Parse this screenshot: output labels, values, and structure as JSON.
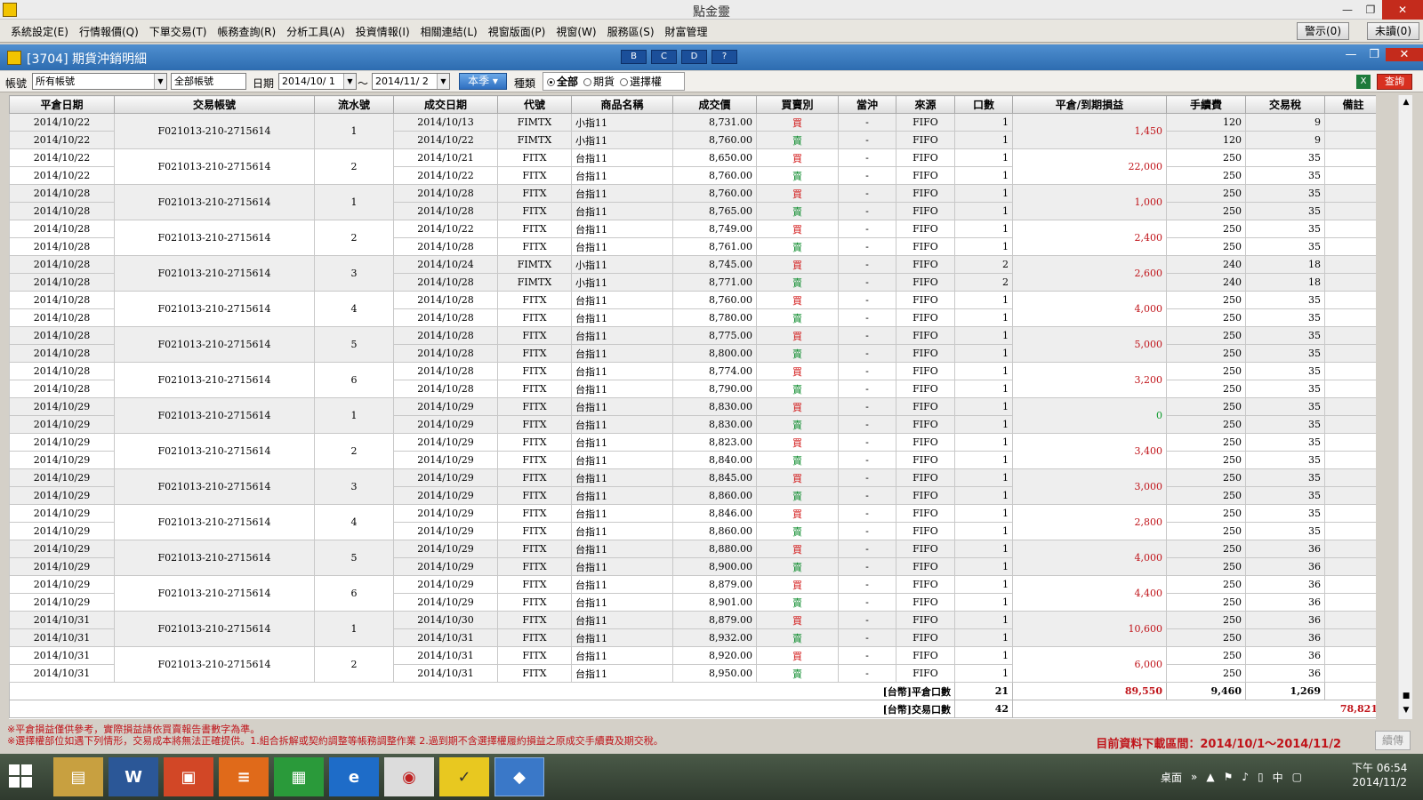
{
  "window": {
    "title": "點金靈"
  },
  "menu": {
    "items": [
      "系統設定(E)",
      "行情報價(Q)",
      "下單交易(T)",
      "帳務查詢(R)",
      "分析工具(A)",
      "投資情報(I)",
      "相關連結(L)",
      "視窗版面(P)",
      "視窗(W)",
      "服務區(S)",
      "財富管理"
    ],
    "alert": "警示(0)",
    "unread": "未讀(0)"
  },
  "panel": {
    "title": "[3704] 期貨沖銷明細",
    "tools": [
      "B",
      "C",
      "D",
      "?"
    ]
  },
  "filter": {
    "account_label": "帳號",
    "account_value": "所有帳號",
    "account_text": "全部帳號",
    "date_label": "日期",
    "date_from": "2014/10/ 1",
    "tilde": "～",
    "date_to": "2014/11/ 2",
    "season_button": "本季",
    "type_label": "種類",
    "radio_all": "全部",
    "radio_futures": "期貨",
    "radio_options": "選擇權",
    "query_button": "查詢"
  },
  "columns": [
    "平倉日期",
    "交易帳號",
    "流水號",
    "成交日期",
    "代號",
    "商品名稱",
    "成交價",
    "買賣別",
    "當沖",
    "來源",
    "口數",
    "平倉/到期損益",
    "手續費",
    "交易稅",
    "備註"
  ],
  "groups": [
    {
      "acct": "F021013-210-2715614",
      "serial": "1",
      "pnl": "1,450",
      "rows": [
        [
          "2014/10/22",
          "2014/10/13",
          "FIMTX",
          "小指11",
          "8,731.00",
          "買",
          "-",
          "FIFO",
          "1",
          "120",
          "9"
        ],
        [
          "2014/10/22",
          "2014/10/22",
          "FIMTX",
          "小指11",
          "8,760.00",
          "賣",
          "-",
          "FIFO",
          "1",
          "120",
          "9"
        ]
      ]
    },
    {
      "acct": "F021013-210-2715614",
      "serial": "2",
      "pnl": "22,000",
      "rows": [
        [
          "2014/10/22",
          "2014/10/21",
          "FITX",
          "台指11",
          "8,650.00",
          "買",
          "-",
          "FIFO",
          "1",
          "250",
          "35"
        ],
        [
          "2014/10/22",
          "2014/10/22",
          "FITX",
          "台指11",
          "8,760.00",
          "賣",
          "-",
          "FIFO",
          "1",
          "250",
          "35"
        ]
      ]
    },
    {
      "acct": "F021013-210-2715614",
      "serial": "1",
      "pnl": "1,000",
      "rows": [
        [
          "2014/10/28",
          "2014/10/28",
          "FITX",
          "台指11",
          "8,760.00",
          "買",
          "-",
          "FIFO",
          "1",
          "250",
          "35"
        ],
        [
          "2014/10/28",
          "2014/10/28",
          "FITX",
          "台指11",
          "8,765.00",
          "賣",
          "-",
          "FIFO",
          "1",
          "250",
          "35"
        ]
      ]
    },
    {
      "acct": "F021013-210-2715614",
      "serial": "2",
      "pnl": "2,400",
      "rows": [
        [
          "2014/10/28",
          "2014/10/22",
          "FITX",
          "台指11",
          "8,749.00",
          "買",
          "-",
          "FIFO",
          "1",
          "250",
          "35"
        ],
        [
          "2014/10/28",
          "2014/10/28",
          "FITX",
          "台指11",
          "8,761.00",
          "賣",
          "-",
          "FIFO",
          "1",
          "250",
          "35"
        ]
      ]
    },
    {
      "acct": "F021013-210-2715614",
      "serial": "3",
      "pnl": "2,600",
      "rows": [
        [
          "2014/10/28",
          "2014/10/24",
          "FIMTX",
          "小指11",
          "8,745.00",
          "買",
          "-",
          "FIFO",
          "2",
          "240",
          "18"
        ],
        [
          "2014/10/28",
          "2014/10/28",
          "FIMTX",
          "小指11",
          "8,771.00",
          "賣",
          "-",
          "FIFO",
          "2",
          "240",
          "18"
        ]
      ]
    },
    {
      "acct": "F021013-210-2715614",
      "serial": "4",
      "pnl": "4,000",
      "rows": [
        [
          "2014/10/28",
          "2014/10/28",
          "FITX",
          "台指11",
          "8,760.00",
          "買",
          "-",
          "FIFO",
          "1",
          "250",
          "35"
        ],
        [
          "2014/10/28",
          "2014/10/28",
          "FITX",
          "台指11",
          "8,780.00",
          "賣",
          "-",
          "FIFO",
          "1",
          "250",
          "35"
        ]
      ]
    },
    {
      "acct": "F021013-210-2715614",
      "serial": "5",
      "pnl": "5,000",
      "rows": [
        [
          "2014/10/28",
          "2014/10/28",
          "FITX",
          "台指11",
          "8,775.00",
          "買",
          "-",
          "FIFO",
          "1",
          "250",
          "35"
        ],
        [
          "2014/10/28",
          "2014/10/28",
          "FITX",
          "台指11",
          "8,800.00",
          "賣",
          "-",
          "FIFO",
          "1",
          "250",
          "35"
        ]
      ]
    },
    {
      "acct": "F021013-210-2715614",
      "serial": "6",
      "pnl": "3,200",
      "rows": [
        [
          "2014/10/28",
          "2014/10/28",
          "FITX",
          "台指11",
          "8,774.00",
          "買",
          "-",
          "FIFO",
          "1",
          "250",
          "35"
        ],
        [
          "2014/10/28",
          "2014/10/28",
          "FITX",
          "台指11",
          "8,790.00",
          "賣",
          "-",
          "FIFO",
          "1",
          "250",
          "35"
        ]
      ]
    },
    {
      "acct": "F021013-210-2715614",
      "serial": "1",
      "pnl": "0",
      "rows": [
        [
          "2014/10/29",
          "2014/10/29",
          "FITX",
          "台指11",
          "8,830.00",
          "買",
          "-",
          "FIFO",
          "1",
          "250",
          "35"
        ],
        [
          "2014/10/29",
          "2014/10/29",
          "FITX",
          "台指11",
          "8,830.00",
          "賣",
          "-",
          "FIFO",
          "1",
          "250",
          "35"
        ]
      ]
    },
    {
      "acct": "F021013-210-2715614",
      "serial": "2",
      "pnl": "3,400",
      "rows": [
        [
          "2014/10/29",
          "2014/10/29",
          "FITX",
          "台指11",
          "8,823.00",
          "買",
          "-",
          "FIFO",
          "1",
          "250",
          "35"
        ],
        [
          "2014/10/29",
          "2014/10/29",
          "FITX",
          "台指11",
          "8,840.00",
          "賣",
          "-",
          "FIFO",
          "1",
          "250",
          "35"
        ]
      ]
    },
    {
      "acct": "F021013-210-2715614",
      "serial": "3",
      "pnl": "3,000",
      "rows": [
        [
          "2014/10/29",
          "2014/10/29",
          "FITX",
          "台指11",
          "8,845.00",
          "買",
          "-",
          "FIFO",
          "1",
          "250",
          "35"
        ],
        [
          "2014/10/29",
          "2014/10/29",
          "FITX",
          "台指11",
          "8,860.00",
          "賣",
          "-",
          "FIFO",
          "1",
          "250",
          "35"
        ]
      ]
    },
    {
      "acct": "F021013-210-2715614",
      "serial": "4",
      "pnl": "2,800",
      "rows": [
        [
          "2014/10/29",
          "2014/10/29",
          "FITX",
          "台指11",
          "8,846.00",
          "買",
          "-",
          "FIFO",
          "1",
          "250",
          "35"
        ],
        [
          "2014/10/29",
          "2014/10/29",
          "FITX",
          "台指11",
          "8,860.00",
          "賣",
          "-",
          "FIFO",
          "1",
          "250",
          "35"
        ]
      ]
    },
    {
      "acct": "F021013-210-2715614",
      "serial": "5",
      "pnl": "4,000",
      "rows": [
        [
          "2014/10/29",
          "2014/10/29",
          "FITX",
          "台指11",
          "8,880.00",
          "買",
          "-",
          "FIFO",
          "1",
          "250",
          "36"
        ],
        [
          "2014/10/29",
          "2014/10/29",
          "FITX",
          "台指11",
          "8,900.00",
          "賣",
          "-",
          "FIFO",
          "1",
          "250",
          "36"
        ]
      ]
    },
    {
      "acct": "F021013-210-2715614",
      "serial": "6",
      "pnl": "4,400",
      "rows": [
        [
          "2014/10/29",
          "2014/10/29",
          "FITX",
          "台指11",
          "8,879.00",
          "買",
          "-",
          "FIFO",
          "1",
          "250",
          "36"
        ],
        [
          "2014/10/29",
          "2014/10/29",
          "FITX",
          "台指11",
          "8,901.00",
          "賣",
          "-",
          "FIFO",
          "1",
          "250",
          "36"
        ]
      ]
    },
    {
      "acct": "F021013-210-2715614",
      "serial": "1",
      "pnl": "10,600",
      "rows": [
        [
          "2014/10/31",
          "2014/10/30",
          "FITX",
          "台指11",
          "8,879.00",
          "買",
          "-",
          "FIFO",
          "1",
          "250",
          "36"
        ],
        [
          "2014/10/31",
          "2014/10/31",
          "FITX",
          "台指11",
          "8,932.00",
          "賣",
          "-",
          "FIFO",
          "1",
          "250",
          "36"
        ]
      ]
    },
    {
      "acct": "F021013-210-2715614",
      "serial": "2",
      "pnl": "6,000",
      "rows": [
        [
          "2014/10/31",
          "2014/10/31",
          "FITX",
          "台指11",
          "8,920.00",
          "買",
          "-",
          "FIFO",
          "1",
          "250",
          "36"
        ],
        [
          "2014/10/31",
          "2014/10/31",
          "FITX",
          "台指11",
          "8,950.00",
          "賣",
          "-",
          "FIFO",
          "1",
          "250",
          "36"
        ]
      ]
    }
  ],
  "summary": {
    "close_label": "[台幣]平倉口數",
    "close_qty": "21",
    "close_pnl": "89,550",
    "close_fee": "9,460",
    "close_tax": "1,269",
    "trade_label": "[台幣]交易口數",
    "trade_qty": "42",
    "net_total": "78,821"
  },
  "notes": {
    "line1": "※平倉損益僅供參考，實際損益請依買賣報告書數字為準。",
    "line2": "※選擇權部位如遇下列情形，交易成本將無法正確提供。1.組合拆解或契約調整等帳務調整作業 2.過到期不含選擇權履約損益之原成交手續費及期交稅。",
    "range": "目前資料下載區間：2014/10/1～2014/11/2",
    "resend": "續傳"
  },
  "taskbar": {
    "desktop": "桌面",
    "ime": "中",
    "time": "下午 06:54",
    "date": "2014/11/2"
  },
  "colors": {
    "buy": "#d01010",
    "sell": "#0a8a2a",
    "pnl": "#c0141a",
    "header_blue": "#2d6cb0"
  }
}
